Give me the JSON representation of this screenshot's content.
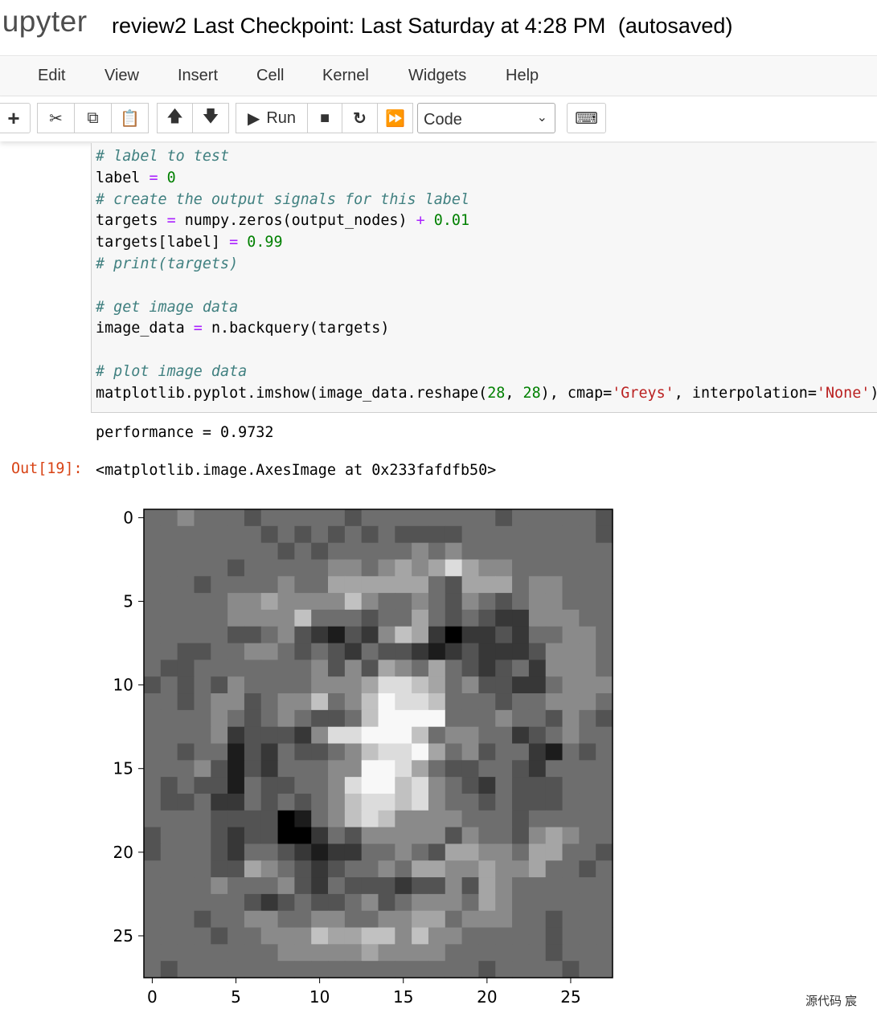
{
  "header": {
    "logo": "jupyter",
    "notebook_name": "review2",
    "checkpoint": "Last Checkpoint: Last Saturday at 4:28 PM",
    "autosave": "(autosaved)"
  },
  "menubar": {
    "items": [
      "Edit",
      "View",
      "Insert",
      "Cell",
      "Kernel",
      "Widgets",
      "Help"
    ]
  },
  "toolbar": {
    "run_label": "Run",
    "cell_type": "Code",
    "icons": [
      "plus-icon",
      "scissors-icon",
      "copy-icon",
      "paste-icon",
      "arrow-up-icon",
      "arrow-down-icon",
      "play-icon",
      "stop-icon",
      "restart-icon",
      "fast-forward-icon",
      "keyboard-icon"
    ]
  },
  "cell": {
    "lines": [
      [
        {
          "t": "# label to test",
          "c": "cm"
        }
      ],
      [
        {
          "t": "label ",
          "c": ""
        },
        {
          "t": "=",
          "c": "op"
        },
        {
          "t": " ",
          "c": ""
        },
        {
          "t": "0",
          "c": "num"
        }
      ],
      [
        {
          "t": "# create the output signals for this label",
          "c": "cm"
        }
      ],
      [
        {
          "t": "targets ",
          "c": ""
        },
        {
          "t": "=",
          "c": "op"
        },
        {
          "t": " numpy.zeros(output_nodes) ",
          "c": ""
        },
        {
          "t": "+",
          "c": "op"
        },
        {
          "t": " ",
          "c": ""
        },
        {
          "t": "0.01",
          "c": "num"
        }
      ],
      [
        {
          "t": "targets[label] ",
          "c": ""
        },
        {
          "t": "=",
          "c": "op"
        },
        {
          "t": " ",
          "c": ""
        },
        {
          "t": "0.99",
          "c": "num"
        }
      ],
      [
        {
          "t": "# print(targets)",
          "c": "cm"
        }
      ],
      [],
      [
        {
          "t": "# get image data",
          "c": "cm"
        }
      ],
      [
        {
          "t": "image_data ",
          "c": ""
        },
        {
          "t": "=",
          "c": "op"
        },
        {
          "t": " n.backquery(targets)",
          "c": ""
        }
      ],
      [],
      [
        {
          "t": "# plot image data",
          "c": "cm"
        }
      ],
      [
        {
          "t": "matplotlib.pyplot.imshow(image_data.reshape(",
          "c": ""
        },
        {
          "t": "28",
          "c": "num"
        },
        {
          "t": ", ",
          "c": ""
        },
        {
          "t": "28",
          "c": "num"
        },
        {
          "t": "), cmap=",
          "c": ""
        },
        {
          "t": "'Greys'",
          "c": "str"
        },
        {
          "t": ", interpolation=",
          "c": ""
        },
        {
          "t": "'None'",
          "c": "str"
        },
        {
          "t": ")",
          "c": ""
        }
      ]
    ],
    "stdout": "performance = 0.9732",
    "out_prompt": "Out[19]:",
    "out_repr": "<matplotlib.image.AxesImage at 0x233fafdfb50>"
  },
  "chart_data": {
    "type": "heatmap",
    "cmap": "Greys",
    "shape": [
      28,
      28
    ],
    "grey_levels_note": "0=black, 9=white, approximate per-pixel brightness",
    "grey_levels": [
      "4454443444443444444443444443",
      "4444444343434343333444444443",
      "4444444434344444545444444444",
      "4444434444455456568655444444",
      "4443444454466666643666455444",
      "4444455655557544543543455444",
      "4444455557444344643432255544",
      "4444433453213257620223244554",
      "4433445543432433212322235554",
      "4334444444535365464323425554",
      "3434354444555688764533224555",
      "4434553455745798874443445554",
      "4444543454334799994445443543",
      "4444523332588999745544234544",
      "4434413243345788964534421434",
      "4445313244455998643344324444",
      "4343314334458997854324333444",
      "4334224343457887854434333444",
      "4444333301457875555444344444",
      "3444323300243555553544356544",
      "3444324432122445436655466443",
      "4444336543234454665565564434",
      "4444544453243332335365444444",
      "4444443234334534555465444444",
      "4443445544554455664555443444",
      "4444344555766775755444443444",
      "4444444455555655554444443444",
      "4344444444444444444434444344"
    ],
    "x_ticks": [
      "0",
      "5",
      "10",
      "15",
      "20",
      "25"
    ],
    "y_ticks": [
      "0",
      "5",
      "10",
      "15",
      "20",
      "25"
    ],
    "xlim": [
      -0.5,
      27.5
    ],
    "ylim": [
      27.5,
      -0.5
    ]
  },
  "watermark": "源代码  宸"
}
